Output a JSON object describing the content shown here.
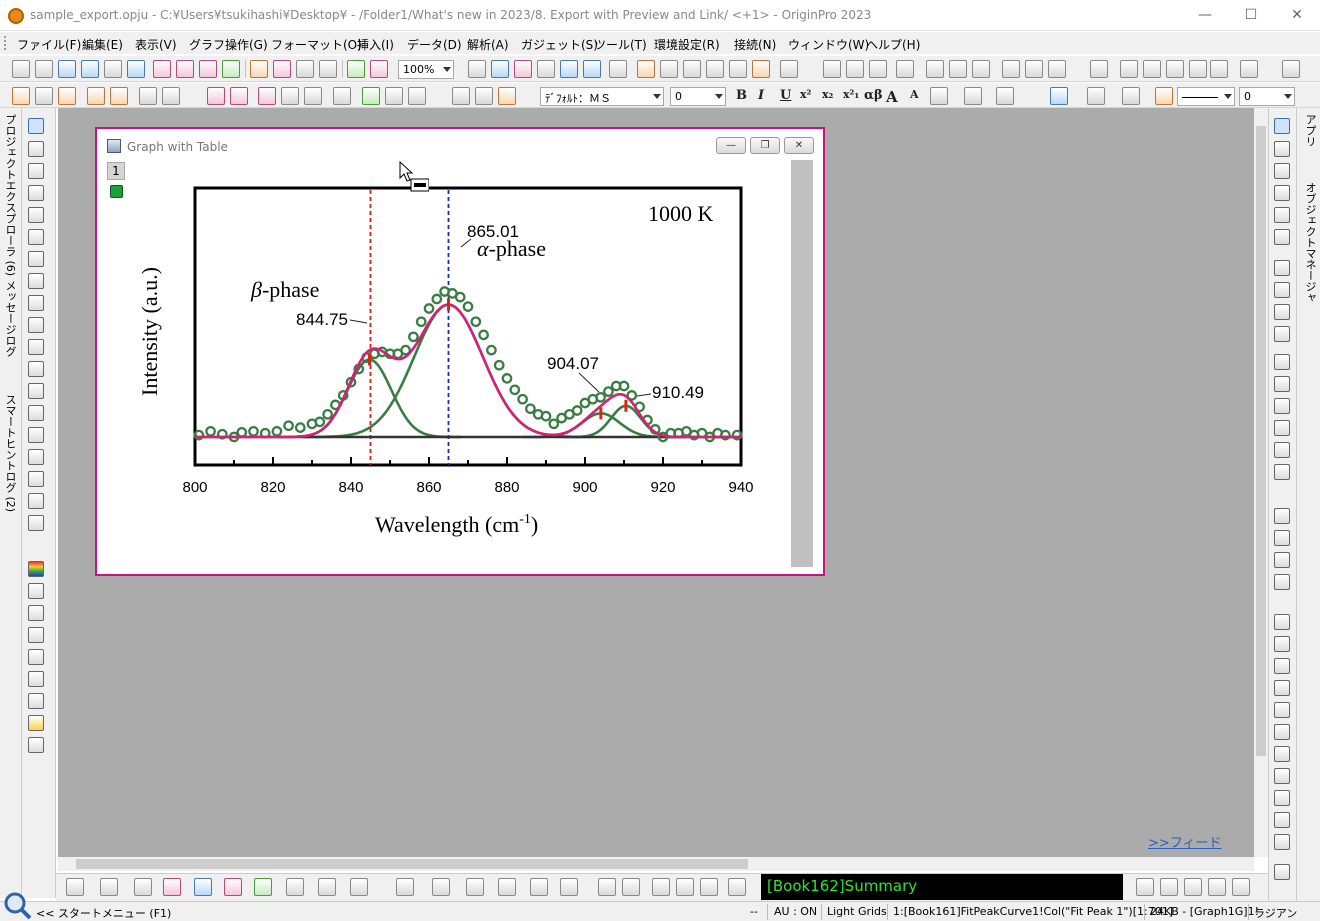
{
  "window": {
    "title": "sample_export.opju - C:¥Users¥tsukihashi¥Desktop¥ - /Folder1/What's new in 2023/8. Export with Preview and Link/ <+1> - OriginPro 2023",
    "minimize": "—",
    "maximize": "☐",
    "close": "✕"
  },
  "menu": [
    "ファイル(F)",
    "編集(E)",
    "表示(V)",
    "グラフ操作(G)",
    "フォーマット(O)",
    "挿入(I)",
    "データ(D)",
    "解析(A)",
    "ガジェット(S)",
    "ツール(T)",
    "環境設定(R)",
    "接続(N)",
    "ウィンドウ(W)",
    "ヘルプ(H)"
  ],
  "toolbar": {
    "zoom": "100%",
    "font": "ﾃﾞﾌｫﾙﾄ：ＭＳ",
    "font_size": "0",
    "line_width": "0",
    "bold": "B",
    "italic": "I",
    "underline": "U",
    "superscript": "x²",
    "subscript": "x₂",
    "supsub": "x²₁",
    "greek": "αβ",
    "increase_font": "A",
    "decrease_font": "A"
  },
  "left_panel": {
    "project_explorer": "プロジェクトエクスプローラ (6)",
    "message_log": "メッセージログ",
    "smart_hint_log": "スマートヒントログ (2)"
  },
  "right_panel": {
    "apps": "アプリ",
    "object_manager": "オブジェクトマネージャ"
  },
  "graph_window": {
    "title": "Graph with Table",
    "layer_number": "1",
    "minimize": "—",
    "restore": "❐",
    "close": "✕"
  },
  "chart_data": {
    "type": "line",
    "xlabel": "Wavelength (cm",
    "xlabel_sup": "-1",
    "xlabel_close": ")",
    "ylabel": "Intensity (a.u.)",
    "xlim": [
      800,
      940
    ],
    "ylim": [
      0,
      1
    ],
    "xticks": [
      "800",
      "820",
      "840",
      "860",
      "880",
      "900",
      "920",
      "940"
    ],
    "temperature_label": "1000 K",
    "phase_labels": {
      "beta_symbol": "β",
      "beta_text": "-phase",
      "alpha_symbol": "α",
      "alpha_text": "-phase"
    },
    "peak_labels": [
      "844.75",
      "865.01",
      "904.07",
      "910.49"
    ],
    "peak_positions": [
      844.75,
      865.01,
      904.07,
      910.49
    ],
    "reference_lines": [
      {
        "x": 845,
        "color": "#d41a1a",
        "style": "dotted"
      },
      {
        "x": 865,
        "color": "#1a2bb8",
        "style": "dotted"
      }
    ],
    "peaks": [
      {
        "center": 844.75,
        "amp": 0.41,
        "sigma": 5.6
      },
      {
        "center": 865.01,
        "amp": 0.7,
        "sigma": 8.8
      },
      {
        "center": 904.07,
        "amp": 0.125,
        "sigma": 4.8
      },
      {
        "center": 910.49,
        "amp": 0.165,
        "sigma": 3.8
      }
    ],
    "points": [
      [
        801,
        0.01
      ],
      [
        804,
        0.03
      ],
      [
        807,
        0.015
      ],
      [
        810,
        0.0
      ],
      [
        812,
        0.025
      ],
      [
        815,
        0.03
      ],
      [
        818,
        0.02
      ],
      [
        821,
        0.03
      ],
      [
        824,
        0.06
      ],
      [
        827,
        0.05
      ],
      [
        830,
        0.07
      ],
      [
        832,
        0.08
      ],
      [
        834,
        0.12
      ],
      [
        836,
        0.17
      ],
      [
        838,
        0.22
      ],
      [
        840,
        0.29
      ],
      [
        842,
        0.36
      ],
      [
        844,
        0.42
      ],
      [
        846,
        0.44
      ],
      [
        848,
        0.45
      ],
      [
        850,
        0.44
      ],
      [
        852,
        0.44
      ],
      [
        854,
        0.46
      ],
      [
        856,
        0.53
      ],
      [
        858,
        0.61
      ],
      [
        860,
        0.68
      ],
      [
        862,
        0.73
      ],
      [
        864,
        0.77
      ],
      [
        866,
        0.76
      ],
      [
        868,
        0.74
      ],
      [
        870,
        0.69
      ],
      [
        872,
        0.61
      ],
      [
        874,
        0.54
      ],
      [
        876,
        0.46
      ],
      [
        878,
        0.38
      ],
      [
        880,
        0.31
      ],
      [
        882,
        0.25
      ],
      [
        884,
        0.2
      ],
      [
        886,
        0.15
      ],
      [
        888,
        0.12
      ],
      [
        890,
        0.11
      ],
      [
        892,
        0.07
      ],
      [
        894,
        0.1
      ],
      [
        896,
        0.12
      ],
      [
        898,
        0.14
      ],
      [
        900,
        0.18
      ],
      [
        902,
        0.2
      ],
      [
        904,
        0.21
      ],
      [
        906,
        0.24
      ],
      [
        908,
        0.27
      ],
      [
        910,
        0.27
      ],
      [
        912,
        0.22
      ],
      [
        914,
        0.16
      ],
      [
        916,
        0.09
      ],
      [
        918,
        0.04
      ],
      [
        920,
        0.0
      ],
      [
        922,
        0.02
      ],
      [
        924,
        0.02
      ],
      [
        926,
        0.03
      ],
      [
        928,
        0.01
      ],
      [
        930,
        0.02
      ],
      [
        932,
        0.0
      ],
      [
        934,
        0.02
      ],
      [
        936,
        0.01
      ],
      [
        939,
        0.01
      ]
    ],
    "colors": {
      "fit": "#d61f78",
      "peaks": "#3a7d44",
      "points": "#3a7d44",
      "baseline": "#333333",
      "markers": "#d42a0c"
    }
  },
  "bottom": {
    "command": "[Book162]Summary",
    "feed_link": ">>フィード"
  },
  "status": {
    "start_menu": "<< スタートメニュー (F1)",
    "dashes": "--",
    "au": "AU : ON",
    "grids": "Light Grids",
    "cell": "1:[Book161]FitPeakCurve1!Col(\"Fit Peak 1\")[1:701]",
    "size": "24KB - [Graph1G]1!",
    "unit": "ラジアン"
  }
}
